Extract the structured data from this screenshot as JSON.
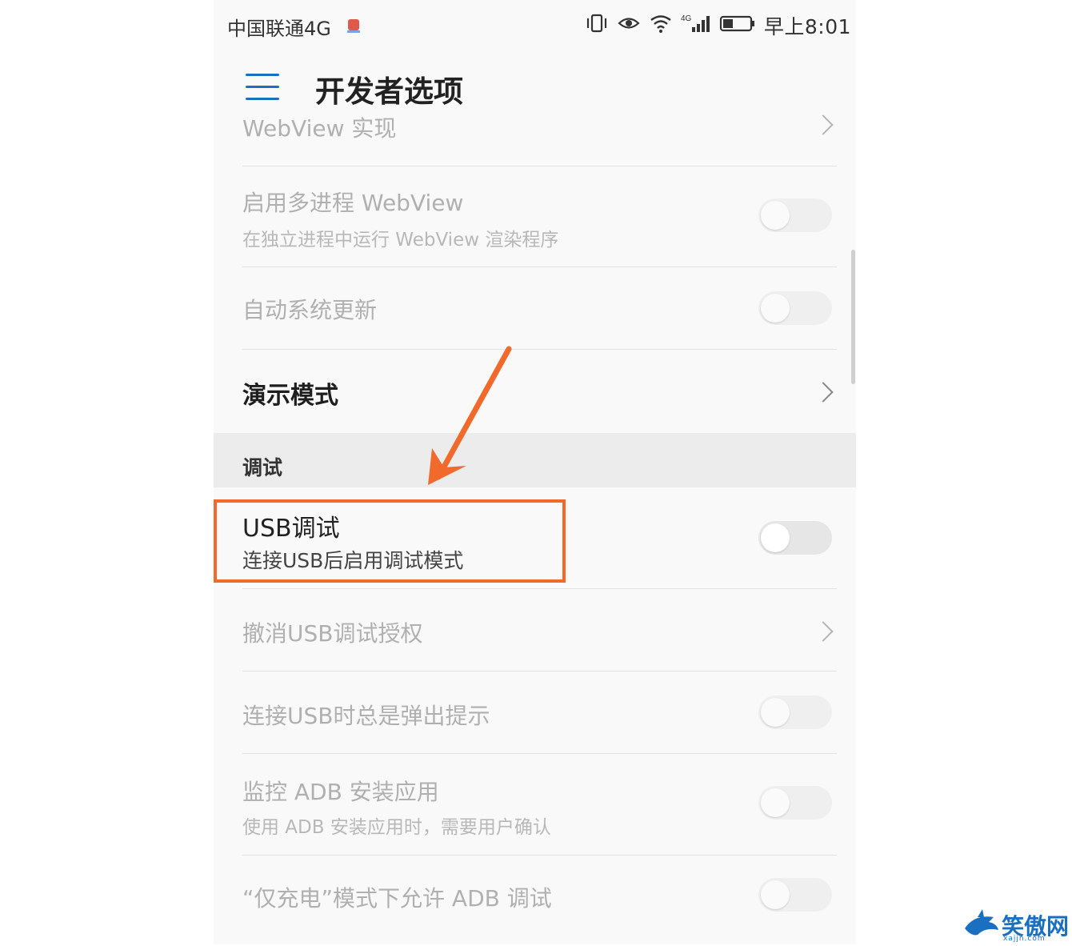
{
  "status_bar": {
    "carrier": "中国联通4G",
    "time": "早上8:01",
    "icons": [
      "vibrate-icon",
      "eye-comfort-icon",
      "wifi-icon",
      "signal-icon",
      "battery-icon"
    ]
  },
  "app_bar": {
    "menu_icon": "menu-icon",
    "title": "开发者选项"
  },
  "settings": {
    "webview_impl": {
      "title": "WebView 实现"
    },
    "multiprocess_webview": {
      "title": "启用多进程 WebView",
      "subtitle": "在独立进程中运行 WebView 渲染程序",
      "enabled": false
    },
    "auto_system_update": {
      "title": "自动系统更新",
      "enabled": false
    },
    "demo_mode": {
      "title": "演示模式"
    },
    "section_debug": {
      "label": "调试"
    },
    "usb_debugging": {
      "title": "USB调试",
      "subtitle": "连接USB后启用调试模式",
      "enabled": false
    },
    "revoke_usb_auth": {
      "title": "撤消USB调试授权"
    },
    "usb_connect_prompt": {
      "title": "连接USB时总是弹出提示",
      "enabled": false
    },
    "monitor_adb_install": {
      "title": "监控 ADB 安装应用",
      "subtitle": "使用 ADB 安装应用时，需要用户确认",
      "enabled": false
    },
    "charge_only_adb": {
      "title": "“仅充电”模式下允许 ADB 调试",
      "enabled": false
    }
  },
  "annotation": {
    "color": "#f26a2b"
  },
  "watermark": {
    "text": "笑傲网",
    "sub": "xajjn.com"
  }
}
